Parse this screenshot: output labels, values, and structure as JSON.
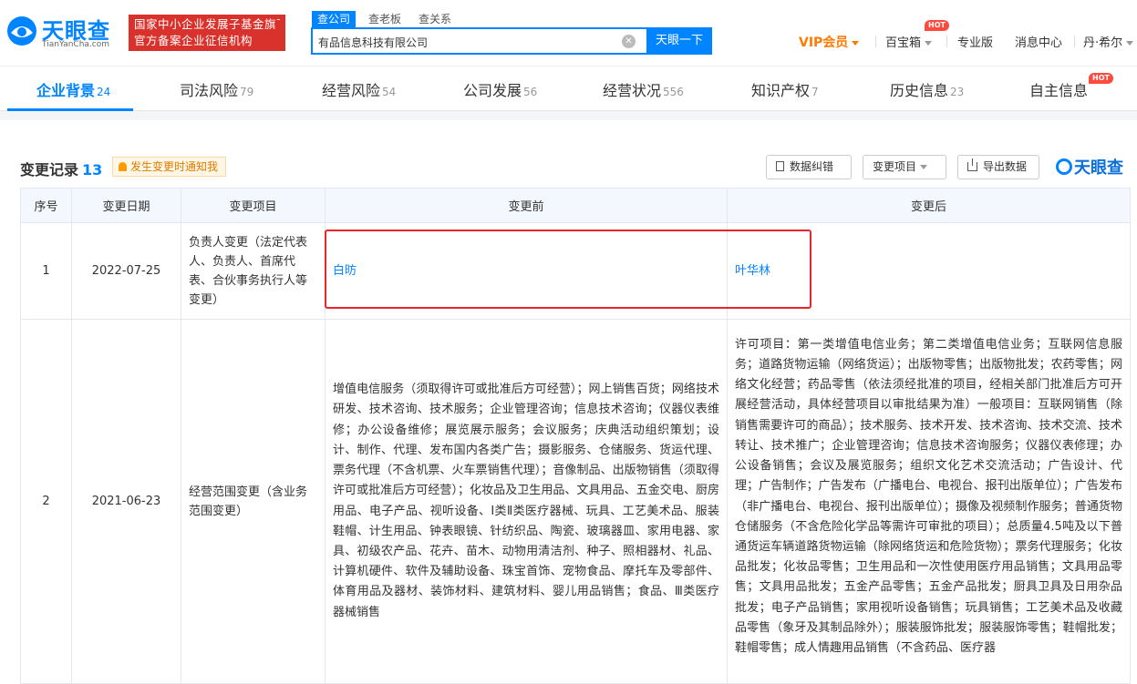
{
  "header": {
    "logo_text": "天眼查",
    "logo_sub": "TianYanCha.com",
    "slogan_line1": "国家中小企业发展子基金旗下",
    "slogan_line2": "官方备案企业征信机构",
    "search_tabs": [
      "查公司",
      "查老板",
      "查关系"
    ],
    "search_value": "有品信息科技有限公司",
    "search_button": "天眼一下",
    "vip": "VIP会员",
    "baibaoxiang": "百宝箱",
    "hot": "HOT",
    "pro": "专业版",
    "messages": "消息中心",
    "user": "丹·希尔"
  },
  "tabs": [
    {
      "label": "企业背景",
      "count": "24"
    },
    {
      "label": "司法风险",
      "count": "79"
    },
    {
      "label": "经营风险",
      "count": "54"
    },
    {
      "label": "公司发展",
      "count": "56"
    },
    {
      "label": "经营状况",
      "count": "556"
    },
    {
      "label": "知识产权",
      "count": "7"
    },
    {
      "label": "历史信息",
      "count": "23"
    },
    {
      "label": "自主信息",
      "count": ""
    }
  ],
  "section": {
    "title": "变更记录",
    "count": "13",
    "notify": "发生变更时通知我",
    "btn_correct": "数据纠错",
    "btn_item": "变更项目",
    "btn_export": "导出数据",
    "watermark": "天眼查"
  },
  "table": {
    "headers": [
      "序号",
      "变更日期",
      "变更项目",
      "变更前",
      "变更后"
    ],
    "rows": [
      {
        "no": "1",
        "date": "2022-07-25",
        "item": "负责人变更（法定代表人、负责人、首席代表、合伙事务执行人等变更）",
        "before": "白昉",
        "after": "叶华林"
      },
      {
        "no": "2",
        "date": "2021-06-23",
        "item": "经营范围变更（含业务范围变更）",
        "before": "增值电信服务（须取得许可或批准后方可经营）；网上销售百货；网络技术研发、技术咨询、技术服务；企业管理咨询；信息技术咨询；仪器仪表维修；办公设备维修；展览展示服务；会议服务；庆典活动组织策划；设计、制作、代理、发布国内各类广告；摄影服务、仓储服务、货运代理、票务代理（不含机票、火车票销售代理）；音像制品、出版物销售（须取得许可或批准后方可经营）；化妆品及卫生用品、文具用品、五金交电、厨房用品、电子产品、视听设备、Ⅰ类Ⅱ类医疗器械、玩具、工艺美术品、服装鞋帽、计生用品、钟表眼镜、针纺织品、陶瓷、玻璃器皿、家用电器、家具、初级农产品、花卉、苗木、动物用清洁剂、种子、照相器材、礼品、计算机硬件、软件及辅助设备、珠宝首饰、宠物食品、摩托车及零部件、体育用品及器材、装饰材料、建筑材料、婴儿用品销售；食品、Ⅲ类医疗器械销售",
        "after": "许可项目：第一类增值电信业务；第二类增值电信业务；互联网信息服务；道路货物运输（网络货运）；出版物零售；出版物批发；农药零售；网络文化经营；药品零售（依法须经批准的项目，经相关部门批准后方可开展经营活动，具体经营项目以审批结果为准）一般项目：互联网销售（除销售需要许可的商品）；技术服务、技术开发、技术咨询、技术交流、技术转让、技术推广；企业管理咨询；信息技术咨询服务；仪器仪表修理；办公设备销售；会议及展览服务；组织文化艺术交流活动；广告设计、代理；广告制作；广告发布（广播电台、电视台、报刊出版单位）；广告发布（非广播电台、电视台、报刊出版单位）；摄像及视频制作服务；普通货物仓储服务（不含危险化学品等需许可审批的项目）；总质量4.5吨及以下普通货运车辆道路货物运输（除网络货运和危险货物）；票务代理服务；化妆品批发；化妆品零售；卫生用品和一次性使用医疗用品销售；文具用品零售；文具用品批发；五金产品零售；五金产品批发；厨具卫具及日用杂品批发；电子产品销售；家用视听设备销售；玩具销售；工艺美术品及收藏品零售（象牙及其制品除外）；服装服饰批发；服装服饰零售；鞋帽批发；鞋帽零售；成人情趣用品销售（不含药品、医疗器"
      }
    ]
  }
}
